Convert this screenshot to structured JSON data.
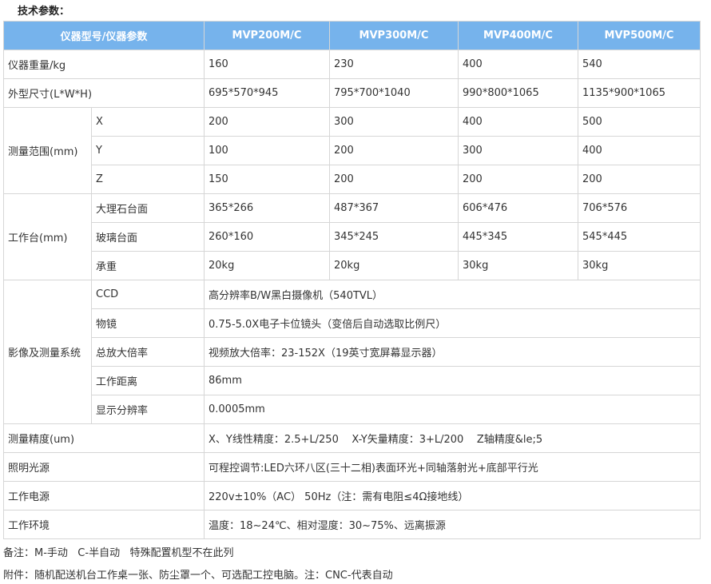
{
  "heading": "技术参数：",
  "header": {
    "param": "仪器型号/仪器参数",
    "models": [
      "MVP200M/C",
      "MVP300M/C",
      "MVP400M/C",
      "MVP500M/C"
    ]
  },
  "rows": {
    "weight": {
      "label": "仪器重量/kg",
      "values": [
        "160",
        "230",
        "400",
        "540"
      ]
    },
    "dims": {
      "label": "外型尺寸(L*W*H)",
      "values": [
        "695*570*945",
        "795*700*1040",
        "990*800*1065",
        "1135*900*1065"
      ]
    },
    "range": {
      "label": "测量范围(mm)",
      "x": {
        "label": "X",
        "values": [
          "200",
          "300",
          "400",
          "500"
        ]
      },
      "y": {
        "label": "Y",
        "values": [
          "100",
          "200",
          "300",
          "400"
        ]
      },
      "z": {
        "label": "Z",
        "values": [
          "150",
          "200",
          "200",
          "200"
        ]
      }
    },
    "table": {
      "label": "工作台(mm)",
      "marble": {
        "label": "大理石台面",
        "values": [
          "365*266",
          "487*367",
          "606*476",
          "706*576"
        ]
      },
      "glass": {
        "label": "玻璃台面",
        "values": [
          "260*160",
          "345*245",
          "445*345",
          "545*445"
        ]
      },
      "load": {
        "label": "承重",
        "values": [
          "20kg",
          "20kg",
          "30kg",
          "30kg"
        ]
      }
    },
    "imaging": {
      "label": "影像及测量系统",
      "ccd": {
        "label": "CCD",
        "value": "高分辨率B/W黑白摄像机（540TVL）"
      },
      "lens": {
        "label": "物镜",
        "value": "0.75-5.0X电子卡位镜头（变倍后自动选取比例尺）"
      },
      "mag": {
        "label": "总放大倍率",
        "value": "视频放大倍率：23-152X（19英寸宽屏幕显示器）"
      },
      "dist": {
        "label": "工作距离",
        "value": "86mm"
      },
      "res": {
        "label": "显示分辨率",
        "value": "0.0005mm"
      }
    },
    "accuracy": {
      "label": "测量精度(um)",
      "value": "X、Y线性精度：2.5+L/250    X-Y矢量精度：3+L/200    Z轴精度&le;5"
    },
    "light": {
      "label": "照明光源",
      "value": "可程控调节:LED六环八区(三十二相)表面环光+同轴落射光+底部平行光"
    },
    "power": {
      "label": "工作电源",
      "value": "220v±10%（AC） 50Hz（注：需有电阻≤4Ω接地线）"
    },
    "env": {
      "label": "工作环境",
      "value": "温度：18~24℃、相对湿度：30~75%、远离振源"
    }
  },
  "notes": {
    "note1": "备注：M-手动   C-半自动   特殊配置机型不在此列",
    "note2": "附件：随机配送机台工作桌一张、防尘罩一个、可选配工控电脑。注：CNC-代表自动"
  },
  "colors": {
    "header_bg": "#76b3ec",
    "border": "#d6d6d6",
    "text": "#333333"
  }
}
